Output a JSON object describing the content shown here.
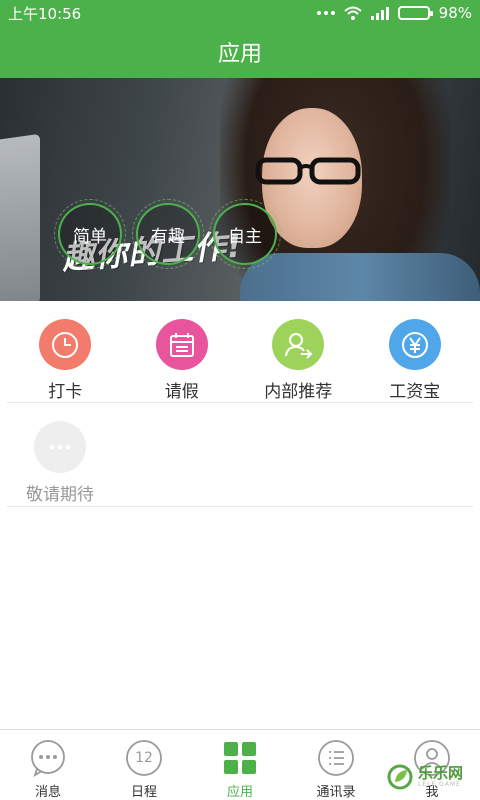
{
  "status_bar": {
    "time": "上午10:56",
    "battery": "98%",
    "battery_level": 0.98
  },
  "title_bar": {
    "title": "应用"
  },
  "banner": {
    "slogan": "趣你的工作!",
    "pills": [
      "简单",
      "有趣",
      "自主"
    ]
  },
  "apps": [
    {
      "label": "打卡",
      "icon": "clock-icon",
      "color": "#f37b6b"
    },
    {
      "label": "请假",
      "icon": "calendar-icon",
      "color": "#e9559d"
    },
    {
      "label": "内部推荐",
      "icon": "referral-user-icon",
      "color": "#9dd35b"
    },
    {
      "label": "工资宝",
      "icon": "yuan-icon",
      "color": "#4fa7ea"
    }
  ],
  "coming_soon": {
    "label": "敬请期待",
    "icon": "more-dots-icon",
    "color": "#eeeeee"
  },
  "tabs": [
    {
      "label": "消息",
      "icon": "chat-bubble-icon",
      "active": false
    },
    {
      "label": "日程",
      "icon": "calendar-day-icon",
      "badge_text": "12",
      "active": false
    },
    {
      "label": "应用",
      "icon": "apps-grid-icon",
      "active": true
    },
    {
      "label": "通讯录",
      "icon": "contacts-list-icon",
      "active": false
    },
    {
      "label": "我",
      "icon": "profile-icon",
      "active": false
    }
  ],
  "watermark": {
    "text": "乐乐网",
    "sub": "LELE GAME"
  },
  "colors": {
    "brand_green": "#4cb14a",
    "tab_icon_gray": "#9a9a9a"
  }
}
